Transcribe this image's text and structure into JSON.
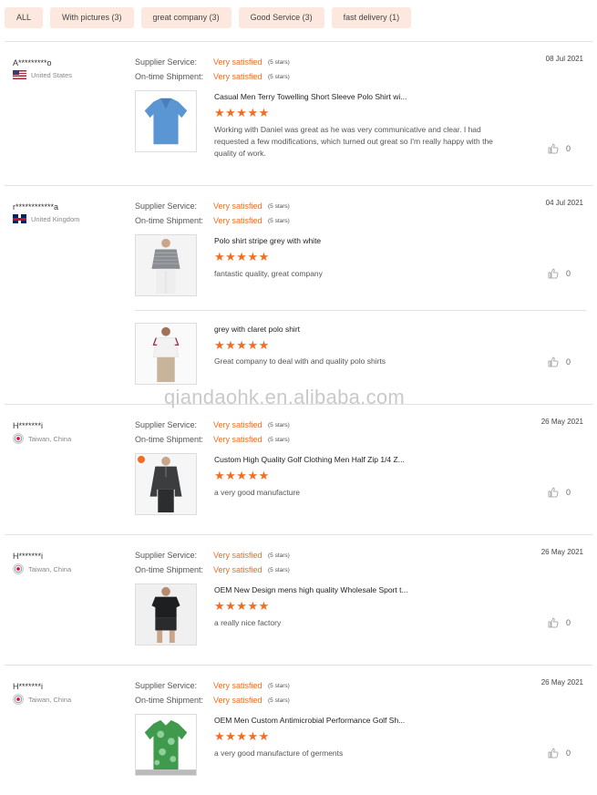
{
  "filters": [
    "ALL",
    "With pictures (3)",
    "great company (3)",
    "Good Service (3)",
    "fast delivery (1)"
  ],
  "rating_labels": {
    "supplier": "Supplier Service:",
    "shipment": "On-time Shipment:"
  },
  "watermark": "qiandaohk.en.alibaba.com",
  "reviews": [
    {
      "user": "A*********o",
      "country": "United States",
      "date": "08 Jul 2021",
      "supplier_value": "Very satisfied",
      "supplier_stars": "(5 stars)",
      "shipment_value": "Very satisfied",
      "shipment_stars": "(5 stars)",
      "items": [
        {
          "name": "Casual Men Terry Towelling Short Sleeve Polo Shirt wi...",
          "rating": 5,
          "comment": "Working with Daniel was great as he was very communicative and clear. I had requested a few modifications, which turned out great so I'm really happy with the quality of work.",
          "likes": "0"
        }
      ]
    },
    {
      "user": "r************a",
      "country": "United Kingdom",
      "date": "04 Jul 2021",
      "supplier_value": "Very satisfied",
      "supplier_stars": "(5 stars)",
      "shipment_value": "Very satisfied",
      "shipment_stars": "(5 stars)",
      "items": [
        {
          "name": "Polo shirt stripe grey with white",
          "rating": 5,
          "comment": "fantastic quality, great company",
          "likes": "0"
        },
        {
          "name": "grey with claret polo shirt",
          "rating": 5,
          "comment": "Great company to deal with and quality polo shirts",
          "likes": "0"
        }
      ]
    },
    {
      "user": "H*******i",
      "country": "Taiwan, China",
      "date": "26 May 2021",
      "supplier_value": "Very satisfied",
      "supplier_stars": "(5 stars)",
      "shipment_value": "Very satisfied",
      "shipment_stars": "(5 stars)",
      "items": [
        {
          "name": "Custom High Quality Golf Clothing Men Half Zip 1/4 Z...",
          "rating": 5,
          "comment": "a very good manufacture",
          "likes": "0"
        }
      ]
    },
    {
      "user": "H*******i",
      "country": "Taiwan, China",
      "date": "26 May 2021",
      "supplier_value": "Very satisfied",
      "supplier_stars": "(5 stars)",
      "shipment_value": "Very satisfied",
      "shipment_stars": "(5 stars)",
      "items": [
        {
          "name": "OEM New Design mens high quality Wholesale Sport t...",
          "rating": 5,
          "comment": "a really nice factory",
          "likes": "0"
        }
      ]
    },
    {
      "user": "H*******i",
      "country": "Taiwan, China",
      "date": "26 May 2021",
      "supplier_value": "Very satisfied",
      "supplier_stars": "(5 stars)",
      "shipment_value": "Very satisfied",
      "shipment_stars": "(5 stars)",
      "items": [
        {
          "name": "OEM Men Custom Antimicrobial Performance Golf Sh...",
          "rating": 5,
          "comment": "a very good manufacture of germents",
          "likes": "0"
        }
      ]
    }
  ],
  "colors": {
    "accent": "#f26d21",
    "chip_bg": "#fde8e0",
    "divider": "#e2e2e2"
  },
  "icons": {
    "like": "thumbs-up-icon",
    "star": "star-icon"
  }
}
